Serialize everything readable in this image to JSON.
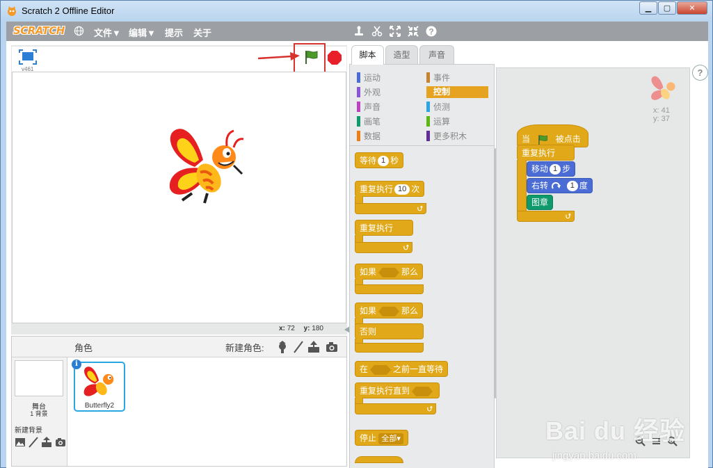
{
  "window": {
    "title": "Scratch 2 Offline Editor",
    "min_label": "▁",
    "max_label": "▢",
    "close_label": "✕"
  },
  "menubar": {
    "logo": "SCRATCH",
    "items": [
      "文件▼",
      "编辑▼",
      "提示",
      "关于"
    ]
  },
  "stage": {
    "version": "v461",
    "x_label": "x:",
    "x_value": "72",
    "y_label": "y:",
    "y_value": "180"
  },
  "sprites": {
    "header_label": "角色",
    "new_sprite_label": "新建角色:",
    "stage_label": "舞台",
    "backdrop_count": "1 背景",
    "new_backdrop_label": "新建背景",
    "sprite_name": "Butterfly2",
    "info_label": "i"
  },
  "tabs": [
    "脚本",
    "造型",
    "声音"
  ],
  "categories": {
    "left": [
      {
        "label": "运动",
        "color": "#4a6cd4"
      },
      {
        "label": "外观",
        "color": "#8a55d7"
      },
      {
        "label": "声音",
        "color": "#bb42c3"
      },
      {
        "label": "画笔",
        "color": "#0e9a6c"
      },
      {
        "label": "数据",
        "color": "#ee7d16"
      }
    ],
    "right": [
      {
        "label": "事件",
        "color": "#c88330"
      },
      {
        "label": "控制",
        "color": "#e1a91a"
      },
      {
        "label": "侦测",
        "color": "#2ca5e2"
      },
      {
        "label": "运算",
        "color": "#5cb712"
      },
      {
        "label": "更多积木",
        "color": "#632d99"
      }
    ]
  },
  "blocks": {
    "wait": "等待",
    "wait_num": "1",
    "wait_unit": "秒",
    "repeat": "重复执行",
    "repeat_num": "10",
    "repeat_unit": "次",
    "forever": "重复执行",
    "if": "如果",
    "then": "那么",
    "if2": "如果",
    "then2": "那么",
    "else": "否则",
    "wait_until_pre": "在",
    "wait_until_post": "之前一直等待",
    "repeat_until": "重复执行直到",
    "stop": "停止",
    "stop_option": "全部▾"
  },
  "script": {
    "hat_pre": "当",
    "hat_post": "被点击",
    "forever": "重复执行",
    "move_label": "移动",
    "move_num": "1",
    "move_unit": "步",
    "turn_label": "右转",
    "turn_num": "1",
    "turn_unit": "度",
    "stamp": "图章",
    "x_readout": "x: 41",
    "y_readout": "y: 37"
  },
  "help_label": "?",
  "watermark": {
    "main": "Bai du 经验",
    "sub": "jingyan.baidu.com"
  },
  "colors": {
    "control": "#e1a91a",
    "motion": "#4a6cd4",
    "pen": "#0e9a6c",
    "menubar": "#9c9fa3",
    "highlight": "#d8322f"
  }
}
